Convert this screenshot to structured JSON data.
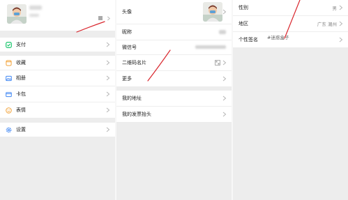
{
  "colors": {
    "background": "#ededed",
    "card": "#ffffff",
    "annotation": "#d9272e",
    "pay_icon": "#07c160",
    "favorites_icon": "#f2a33a",
    "album_icon": "#3f86f3",
    "cards_icon": "#3f86f3",
    "sticker_icon": "#f2a33a",
    "settings_icon": "#3f86f3"
  },
  "me_page": {
    "menu": [
      {
        "label": "支付",
        "icon": "pay-icon"
      },
      {
        "label": "收藏",
        "icon": "favorites-icon"
      },
      {
        "label": "相册",
        "icon": "album-icon"
      },
      {
        "label": "卡包",
        "icon": "cards-icon"
      },
      {
        "label": "表情",
        "icon": "sticker-icon"
      },
      {
        "label": "设置",
        "icon": "settings-icon"
      }
    ]
  },
  "profile_page": {
    "rows": [
      {
        "label": "头像"
      },
      {
        "label": "昵称"
      },
      {
        "label": "微信号"
      },
      {
        "label": "二维码名片"
      },
      {
        "label": "更多"
      },
      {
        "label": "我的地址"
      },
      {
        "label": "我的发票抬头"
      }
    ]
  },
  "more_page": {
    "gender_label": "性别",
    "gender_value": "男",
    "region_label": "地区",
    "region_value": "广东 潮州",
    "signature_label": "个性签名",
    "signature_value": "#迷惑盒子"
  }
}
